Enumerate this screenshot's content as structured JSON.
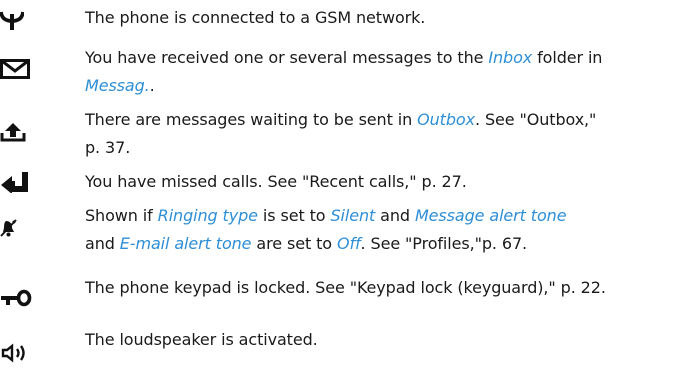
{
  "colors": {
    "text": "#1a1a1a",
    "link": "#2e8fd6",
    "icon": "#111111"
  },
  "entries": [
    {
      "icon": "network-antenna-icon",
      "lines": [
        [
          {
            "t": "The phone is connected to a GSM network."
          }
        ]
      ]
    },
    {
      "icon": "envelope-icon",
      "lines": [
        [
          {
            "t": "You have received one or several messages to the "
          },
          {
            "t": "Inbox",
            "link": true
          },
          {
            "t": " folder in"
          }
        ],
        [
          {
            "t": "Messag.",
            "link": true
          },
          {
            "t": "."
          }
        ]
      ]
    },
    {
      "icon": "outbox-upload-icon",
      "lines": [
        [
          {
            "t": "There are messages waiting to be sent in "
          },
          {
            "t": "Outbox",
            "link": true
          },
          {
            "t": ". See \"Outbox,\""
          }
        ],
        [
          {
            "t": "p. 37."
          }
        ]
      ]
    },
    {
      "icon": "missed-call-arrow-icon",
      "lines": [
        [
          {
            "t": "You have missed calls. See \"Recent calls,\" p. 27."
          }
        ]
      ]
    },
    {
      "icon": "silent-bell-icon",
      "lines": [
        [
          {
            "t": "Shown if "
          },
          {
            "t": "Ringing type",
            "link": true
          },
          {
            "t": " is set to "
          },
          {
            "t": "Silent",
            "link": true
          },
          {
            "t": " and "
          },
          {
            "t": "Message alert tone",
            "link": true
          }
        ],
        [
          {
            "t": "and "
          },
          {
            "t": "E-mail alert tone",
            "link": true
          },
          {
            "t": " are set to "
          },
          {
            "t": "Off",
            "link": true
          },
          {
            "t": ". See \"Profiles,\"p. 67."
          }
        ]
      ]
    },
    {
      "icon": "keypad-lock-key-icon",
      "lines": [
        [
          {
            "t": "The phone keypad is locked. See \"Keypad lock (keyguard),\" p. 22."
          }
        ]
      ]
    },
    {
      "icon": "loudspeaker-icon",
      "lines": [
        [
          {
            "t": "The loudspeaker is activated."
          }
        ]
      ]
    }
  ]
}
